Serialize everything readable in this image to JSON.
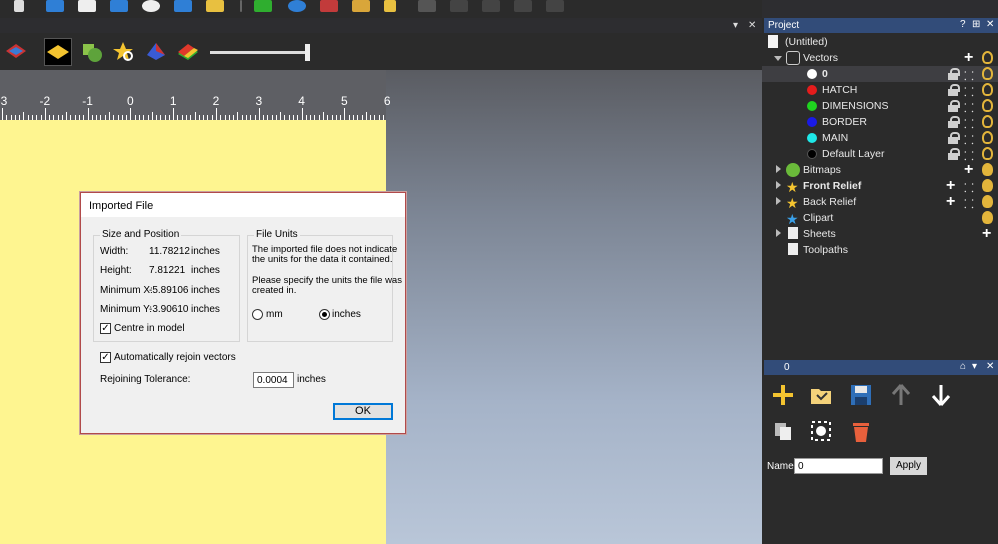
{
  "viewport_controls": {
    "pin": "▾",
    "close": "✕"
  },
  "ruler": {
    "ticks": [
      "-3",
      "-2",
      "-1",
      "0",
      "1",
      "2",
      "3",
      "4",
      "5",
      "6"
    ]
  },
  "dialog": {
    "title": "Imported File",
    "size_group_title": "Size and Position",
    "width_label": "Width:",
    "width_value": "11.78212",
    "width_unit": "inches",
    "height_label": "Height:",
    "height_value": "7.81221",
    "height_unit": "inches",
    "minx_label": "Minimum X:",
    "minx_value": "-5.89106",
    "minx_unit": "inches",
    "miny_label": "Minimum Y:",
    "miny_value": "-3.90610",
    "miny_unit": "inches",
    "centre_label": "Centre in model",
    "centre_checked": true,
    "units_group_title": "File Units",
    "units_msg1_line1": "The imported file does not indicate",
    "units_msg1_line2": "the units for the data it contained.",
    "units_msg2_line1": "Please specify the units the file was",
    "units_msg2_line2": "created in.",
    "unit_mm": "mm",
    "unit_inches": "inches",
    "selected_unit": "inches",
    "rejoin_label": "Automatically rejoin vectors",
    "rejoin_checked": true,
    "tolerance_label": "Rejoining Tolerance:",
    "tolerance_value": "0.0004",
    "tolerance_unit": "inches",
    "ok_label": "OK"
  },
  "project": {
    "header": "Project",
    "header_controls": {
      "help": "?",
      "pin": "⊞",
      "close": "✕"
    },
    "tree": {
      "root": "(Untitled)",
      "vectors": "Vectors",
      "layers": [
        {
          "name": "0",
          "color": "#ffffff"
        },
        {
          "name": "HATCH",
          "color": "#e51c1c"
        },
        {
          "name": "DIMENSIONS",
          "color": "#1fd41f"
        },
        {
          "name": "BORDER",
          "color": "#1a1ae6"
        },
        {
          "name": "MAIN",
          "color": "#1ee8e8"
        },
        {
          "name": "Default Layer",
          "color": "#000000"
        }
      ],
      "bitmaps": "Bitmaps",
      "front_relief": "Front Relief",
      "back_relief": "Back Relief",
      "clipart": "Clipart",
      "sheets": "Sheets",
      "toolpaths": "Toolpaths"
    }
  },
  "layer_panel": {
    "header": "0",
    "name_label": "Name:",
    "name_value": "0",
    "apply_label": "Apply"
  }
}
